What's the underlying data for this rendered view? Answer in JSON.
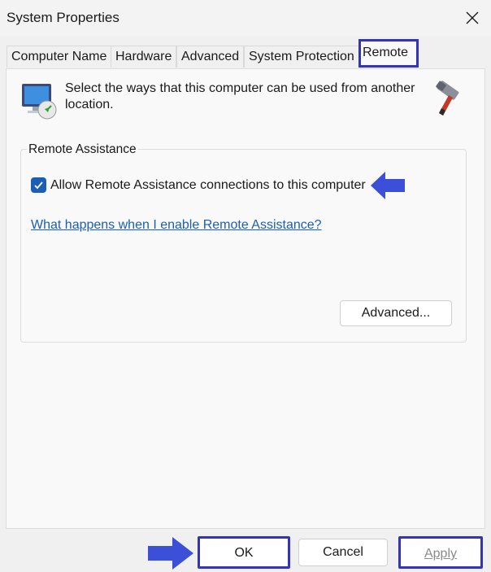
{
  "window": {
    "title": "System Properties"
  },
  "tabs": [
    {
      "label": "Computer Name"
    },
    {
      "label": "Hardware"
    },
    {
      "label": "Advanced"
    },
    {
      "label": "System Protection"
    },
    {
      "label": "Remote",
      "active": true
    }
  ],
  "remote": {
    "intro_text": "Select the ways that this computer can be used from another location.",
    "group_title": "Remote Assistance",
    "allow_checkbox_label": "Allow Remote Assistance connections to this computer",
    "allow_checked": true,
    "help_link": "What happens when I enable Remote Assistance?",
    "advanced_button": "Advanced..."
  },
  "footer": {
    "ok_label": "OK",
    "cancel_label": "Cancel",
    "apply_label": "Apply",
    "apply_enabled": false
  },
  "icons": {
    "remote_desktop": "remote-desktop-icon",
    "hammer": "hammer-icon",
    "annotation_arrow": "annotation-arrow-icon",
    "close": "close-icon",
    "checkmark": "checkmark-icon"
  },
  "colors": {
    "highlight_border": "#3434b8",
    "checkbox_fill": "#1a5fb4",
    "link": "#1a5fb4",
    "arrow_fill": "#3b4fd8"
  }
}
